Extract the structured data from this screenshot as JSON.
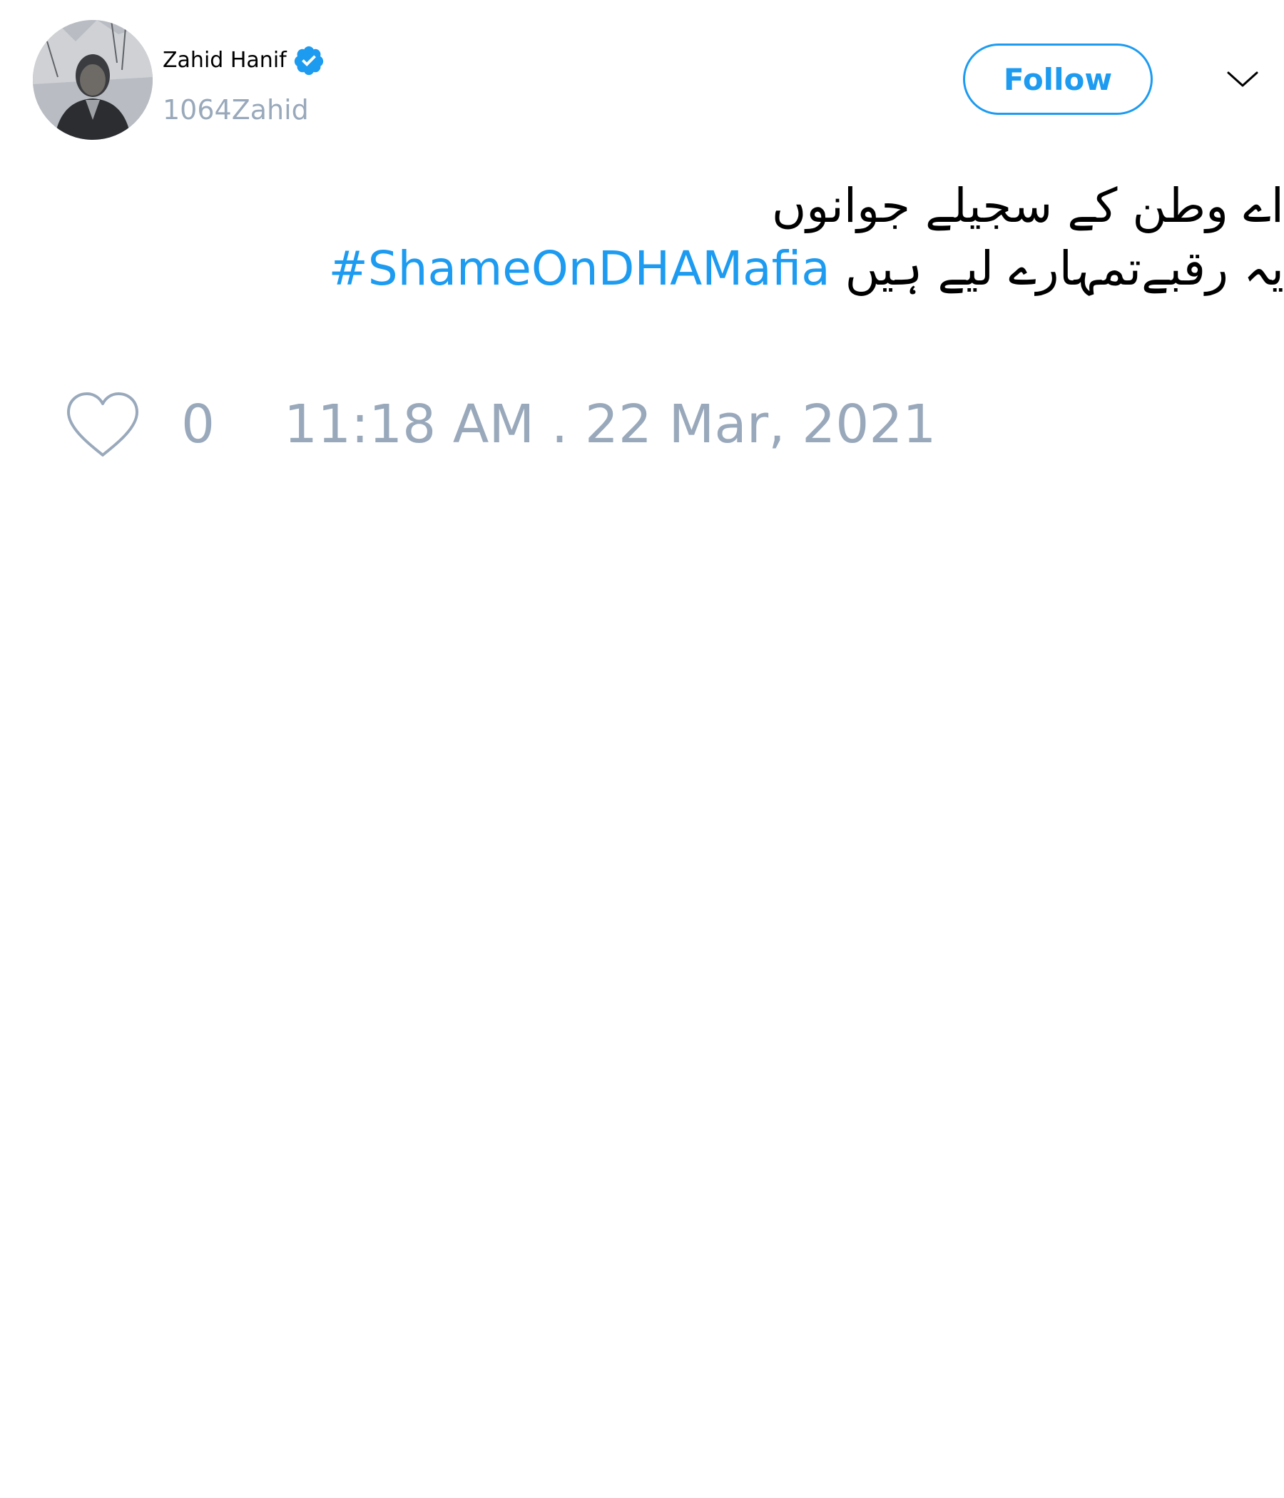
{
  "author": {
    "name": "Zahid Hanif",
    "handle": "1064Zahid",
    "verified": true,
    "avatar_icon": "profile-photo"
  },
  "actions": {
    "follow_label": "Follow",
    "menu_icon": "chevron-down-icon"
  },
  "tweet": {
    "line1": "اے وطن کے سجیلے جوانوں",
    "line2_text": "یہ رقبےتمہارے لیے ہیں ",
    "hashtag": "#ShameOnDHAMafia"
  },
  "footer": {
    "like_icon": "heart-icon",
    "like_count": "0",
    "timestamp": "11:18 AM . 22 Mar, 2021"
  },
  "colors": {
    "accent": "#1d9bf0",
    "muted": "#99a9bb",
    "text": "#000000",
    "background": "#ffffff"
  }
}
